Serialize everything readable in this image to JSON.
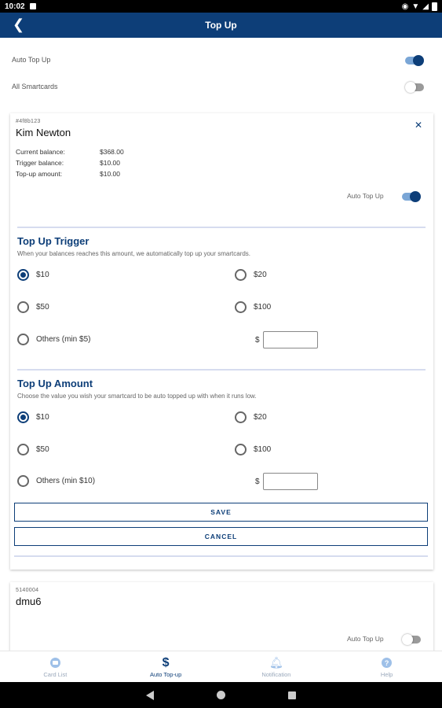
{
  "status": {
    "time": "10:02"
  },
  "app_bar": {
    "title": "Top Up",
    "back_icon": "arrow-left-icon"
  },
  "settings": {
    "auto_top_up_label": "Auto Top Up",
    "auto_top_up_on": true,
    "all_smartcards_label": "All Smartcards",
    "all_smartcards_on": false
  },
  "card1": {
    "id": "#4f8b123",
    "name": "Kim Newton",
    "rows": [
      {
        "label": "Current balance:",
        "value": "$368.00"
      },
      {
        "label": "Trigger balance:",
        "value": "$10.00"
      },
      {
        "label": "Top-up amount:",
        "value": "$10.00"
      }
    ],
    "auto_label": "Auto Top Up",
    "auto_on": true,
    "trigger": {
      "title": "Top Up Trigger",
      "desc": "When your balances reaches this amount, we automatically top up your smartcards.",
      "options": [
        "$10",
        "$20",
        "$50",
        "$100",
        "Others (min $5)"
      ],
      "selected": "$10",
      "currency": "$",
      "other_value": ""
    },
    "amount": {
      "title": "Top Up Amount",
      "desc": "Choose the value you wish your smartcard to be auto topped up with when it runs low.",
      "options": [
        "$10",
        "$20",
        "$50",
        "$100",
        "Others (min $10)"
      ],
      "selected": "$10",
      "currency": "$",
      "other_value": ""
    },
    "save_label": "SAVE",
    "cancel_label": "CANCEL"
  },
  "card2": {
    "id": "5140004",
    "name": "dmu6",
    "auto_label": "Auto Top Up",
    "auto_on": false
  },
  "bottom_nav": [
    {
      "label": "Card List",
      "icon": "card-list-icon"
    },
    {
      "label": "Auto Top-up",
      "icon": "dollar-icon",
      "active": true
    },
    {
      "label": "Notification",
      "icon": "bell-icon"
    },
    {
      "label": "Help",
      "icon": "help-icon"
    }
  ],
  "colors": {
    "primary": "#0d3e78",
    "toggle_track_on": "#7aa6d6",
    "divider": "#d6dcef"
  }
}
